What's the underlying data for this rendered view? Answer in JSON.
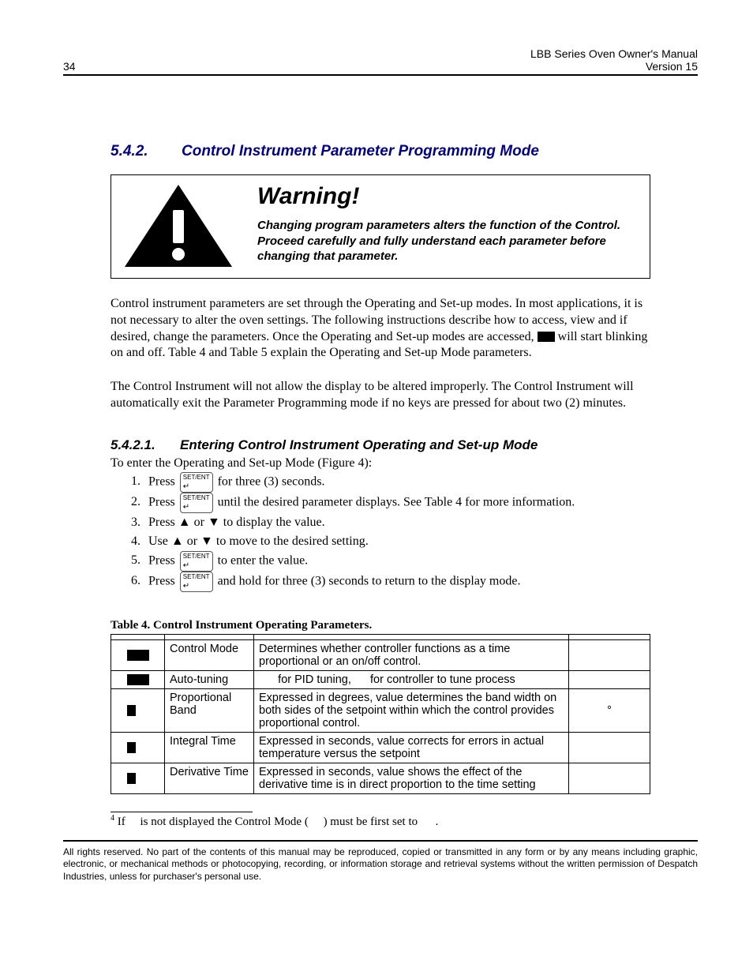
{
  "header": {
    "page_number": "34",
    "title_line1": "LBB Series Oven Owner's Manual",
    "title_line2": "Version 15"
  },
  "section": {
    "number": "5.4.2.",
    "title": "Control Instrument Parameter Programming Mode"
  },
  "warning": {
    "title": "Warning!",
    "body": "Changing program parameters alters the function of the Control. Proceed carefully and fully understand each parameter before changing that parameter."
  },
  "para1_a": "Control instrument parameters are set through the Operating and Set-up modes. In most applications, it is not necessary to alter the oven settings. The following instructions describe how to access, view and if desired, change the parameters. Once the Operating and Set-up modes are accessed, ",
  "para1_b": " will start blinking on and off. Table 4 and Table 5 explain the Operating and Set-up Mode parameters.",
  "para2": "The Control Instrument will not allow the display to be altered improperly. The Control Instrument will automatically exit the Parameter Programming mode if no keys are pressed for about two (2) minutes.",
  "subsection": {
    "number": "5.4.2.1.",
    "title": "Entering Control Instrument Operating and Set-up Mode",
    "intro": "To enter the Operating and Set-up Mode (Figure 4):"
  },
  "key_label": "SET/ENT",
  "steps": {
    "s1a": "Press ",
    "s1b": " for three (3) seconds.",
    "s2a": "Press ",
    "s2b": " until the desired parameter displays. See Table 4 for more information.",
    "s3a": "Press ▲ or ▼ to display the value.",
    "s4a": "Use ▲ or ▼ to move to the desired setting.",
    "s5a": "Press ",
    "s5b": " to enter the value.",
    "s6a": "Press ",
    "s6b": " and hold for three (3) seconds to return to the display mode."
  },
  "table": {
    "caption": "Table 4. Control Instrument Operating Parameters.",
    "rows": [
      {
        "name": "Control Mode",
        "desc": "Determines whether controller functions as a time proportional or an on/off control.",
        "def": ""
      },
      {
        "name": "Auto-tuning",
        "desc_a": "for PID tuning,",
        "desc_b": "for controller to tune process",
        "def": ""
      },
      {
        "name": "Proportional Band",
        "desc": "Expressed in degrees, value determines the band width on both sides of the setpoint within which the control provides proportional control.",
        "def": "°"
      },
      {
        "name": "Integral Time",
        "desc": "Expressed in seconds, value corrects for errors in actual temperature versus the setpoint",
        "def": ""
      },
      {
        "name": "Derivative Time",
        "desc": "Expressed in seconds, value shows the effect of the derivative time is in direct proportion to the time setting",
        "def": ""
      }
    ]
  },
  "footnote": {
    "marker": "4",
    "a": " If ",
    "b": " is not displayed the Control Mode (",
    "c": ") must be first set to ",
    "d": "."
  },
  "footer": "All rights reserved. No part of the contents of this manual may be reproduced, copied or transmitted in any form or by any means including graphic, electronic, or mechanical methods or photocopying, recording, or information storage and retrieval systems without the written permission of Despatch Industries, unless for purchaser's personal use."
}
